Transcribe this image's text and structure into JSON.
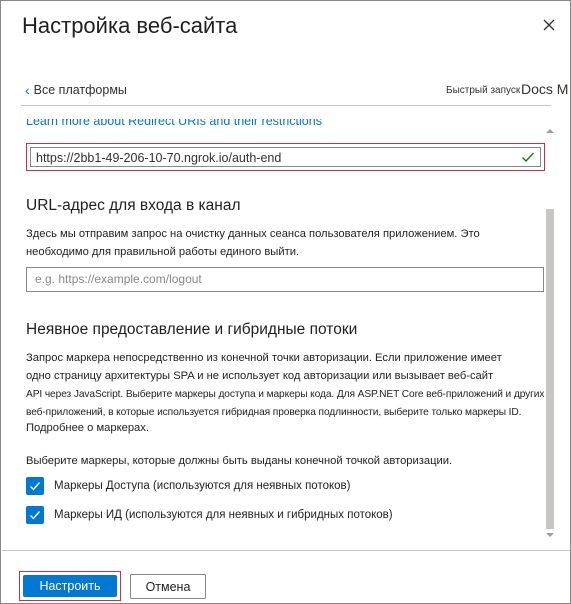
{
  "header": {
    "title": "Настройка веб-сайта",
    "close_icon": "close-icon"
  },
  "nav": {
    "back_label": "Все платформы",
    "quickstart_label": "Быстрый запуск",
    "docs_label": "Docs M"
  },
  "redirect": {
    "learn_more_link": "Learn more about Redirect URIs and their restrictions",
    "uri_value": "https://2bb1-49-206-10-70.ngrok.io/auth-end",
    "valid_icon": "checkmark-icon"
  },
  "logout": {
    "heading": "URL-адрес для входа в канал",
    "desc_line1": "Здесь мы отправим запрос на очистку данных сеанса пользователя приложением. Это",
    "desc_line2": "необходимо для правильной работы единого выйти.",
    "placeholder": "e.g. https://example.com/logout"
  },
  "implicit": {
    "heading": "Неявное предоставление и гибридные потоки",
    "desc_line1": "Запрос маркера непосредственно из конечной точки авторизации. Если приложение имеет",
    "desc_line2": "одно страницу архитектуры SPA и не использует код авторизации или вызывает веб-сайт",
    "desc_line3": "API через JavaScript. Выберите маркеры доступа и маркеры кода. Для ASP.NET Core веб-приложений и других",
    "desc_line4": "веб-приложений, в которые используется гибридная проверка подлинности, выберите только маркеры ID.",
    "more_link": "Подробнее о маркерах.",
    "select_prompt": "Выберите маркеры, которые должны быть выданы конечной точкой авторизации.",
    "options": [
      {
        "label": "Маркеры Доступа (используются для неявных потоков)",
        "checked": true
      },
      {
        "label": "Маркеры ИД (используются для неявных и гибридных потоков)",
        "checked": true
      }
    ]
  },
  "footer": {
    "configure_label": "Настроить",
    "cancel_label": "Отмена"
  },
  "colors": {
    "accent": "#0078d4",
    "error_border": "#c4314b",
    "valid_check": "#107c10"
  }
}
